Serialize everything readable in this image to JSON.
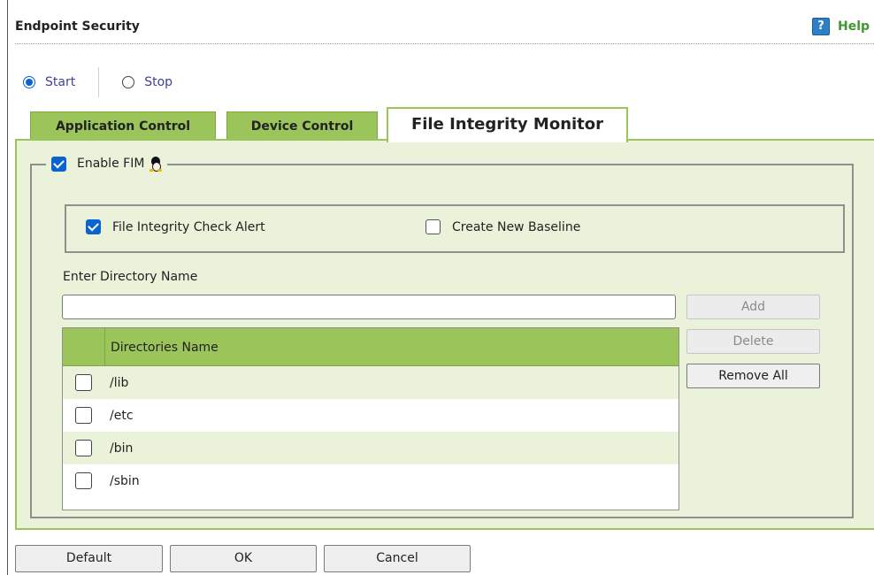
{
  "header": {
    "title": "Endpoint Security",
    "help_label": "Help",
    "help_icon": "question-icon"
  },
  "service": {
    "start_label": "Start",
    "stop_label": "Stop",
    "selected": "Start"
  },
  "tabs": [
    {
      "label": "Application Control",
      "active": false
    },
    {
      "label": "Device Control",
      "active": false
    },
    {
      "label": "File Integrity Monitor",
      "active": true
    }
  ],
  "fim": {
    "enable_label": "Enable FIM",
    "enable_checked": true,
    "os_icon": "linux-icon",
    "alert_label": "File Integrity Check Alert",
    "alert_checked": true,
    "baseline_label": "Create New Baseline",
    "baseline_checked": false,
    "dir_label": "Enter Directory Name",
    "dir_value": "",
    "buttons": {
      "add": "Add",
      "delete": "Delete",
      "remove_all": "Remove All"
    },
    "table": {
      "header": "Directories Name",
      "rows": [
        {
          "name": "/lib",
          "checked": false
        },
        {
          "name": "/etc",
          "checked": false
        },
        {
          "name": "/bin",
          "checked": false
        },
        {
          "name": "/sbin",
          "checked": false
        }
      ]
    }
  },
  "footer": {
    "default_label": "Default",
    "ok_label": "OK",
    "cancel_label": "Cancel"
  },
  "colors": {
    "accent_green": "#9bc45a",
    "panel_green": "#eaf2da",
    "check_blue": "#0a63d1",
    "radio_text": "#3f3f9c",
    "help_green": "#3d9a2e"
  }
}
